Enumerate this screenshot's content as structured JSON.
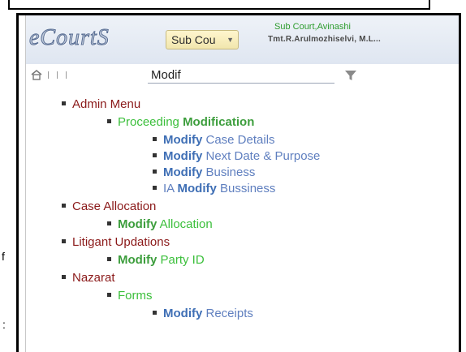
{
  "header": {
    "brand": "eCourtS",
    "court_select_value": "Sub Cou",
    "court_name": "Sub Court,Avinashi",
    "officer_name": "Tmt.R.Arulmozhiselvi, M.L..."
  },
  "toolbar": {
    "search_value": "Modif"
  },
  "left_edge": {
    "char1": "f",
    "char2": ":"
  },
  "tree": {
    "admin_menu": "Admin Menu",
    "proceeding_prefix": "Proceeding ",
    "proceeding_hl": "Modification",
    "modify_case_hl": "Modify",
    "modify_case_rest": " Case Details",
    "modify_next_hl": "Modify",
    "modify_next_rest": " Next Date & Purpose",
    "modify_business_hl": "Modify",
    "modify_business_rest": " Business",
    "ia_prefix": "IA ",
    "ia_hl": "Modify",
    "ia_rest": " Bussiness",
    "case_allocation": "Case Allocation",
    "modify_allocation_hl": "Modify",
    "modify_allocation_rest": " Allocation",
    "litigant_updations": "Litigant Updations",
    "modify_party_hl": "Modify",
    "modify_party_rest": " Party ID",
    "nazarat": "Nazarat",
    "forms": "Forms",
    "modify_receipts_hl": "Modify",
    "modify_receipts_rest": " Receipts"
  },
  "colors": {
    "level0": "#8b1a1a",
    "level1": "#3bbf3b",
    "level2": "#5f7fbf",
    "highlight_green": "#3d9e3d",
    "highlight_blue": "#3f6fb5"
  }
}
